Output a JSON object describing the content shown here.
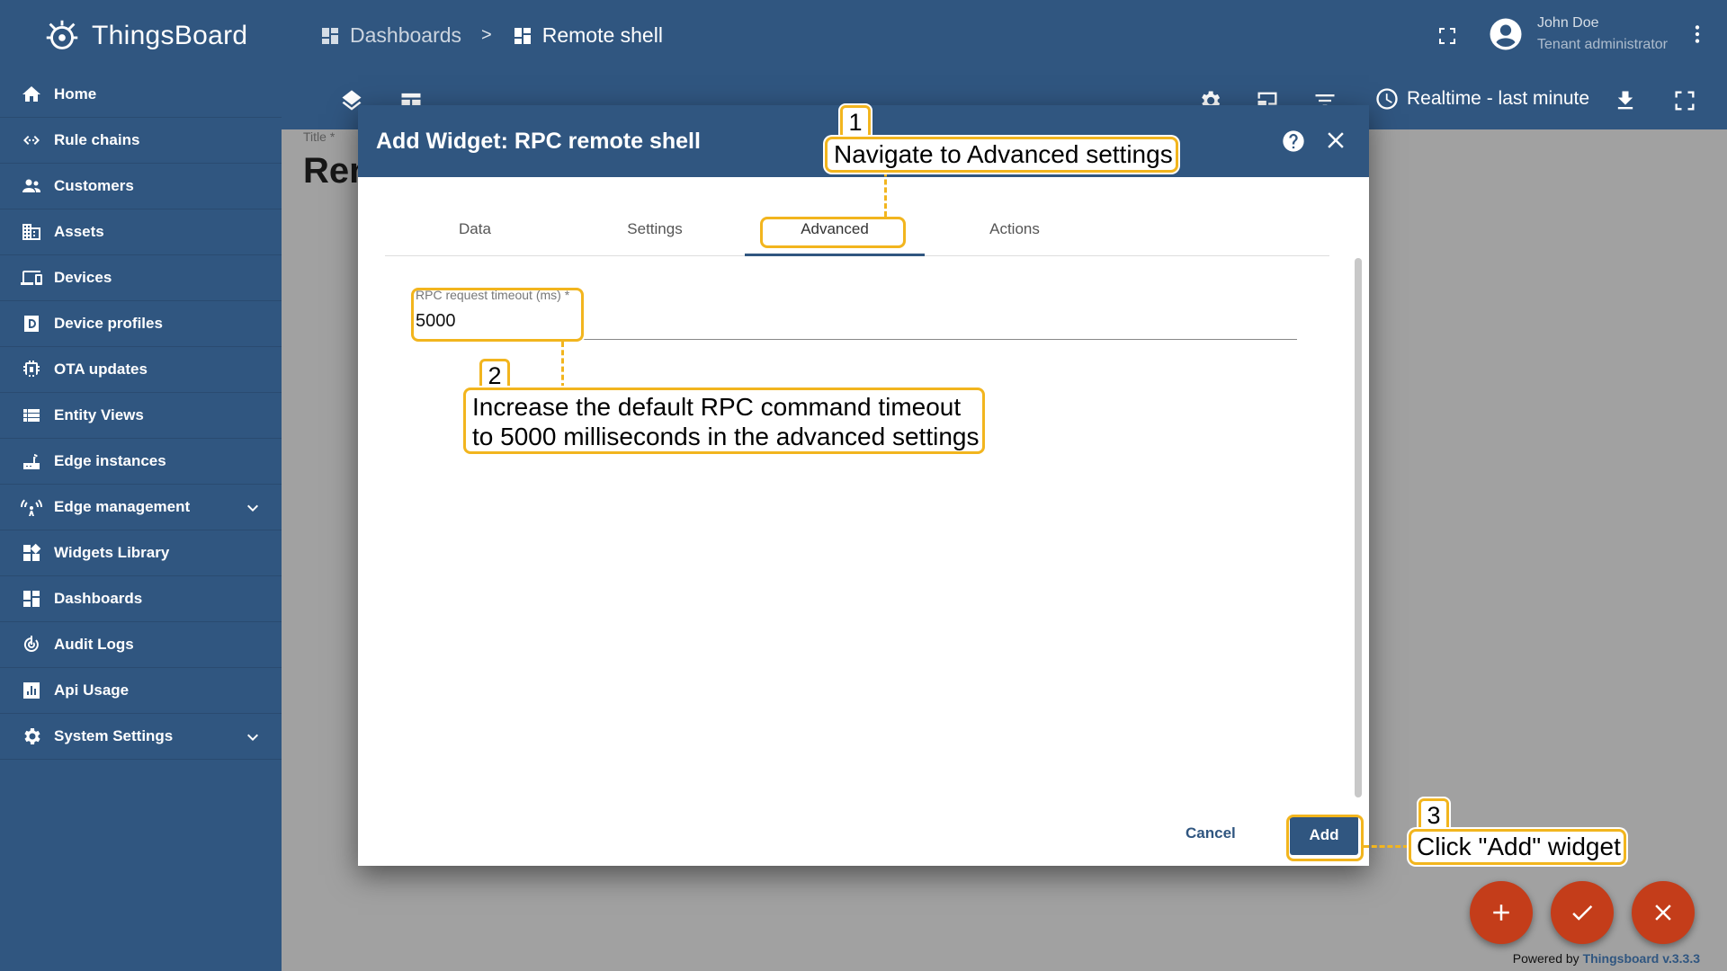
{
  "app": {
    "name": "ThingsBoard",
    "breadcrumbs": [
      "Dashboards",
      "Remote shell"
    ],
    "breadcrumb_separator": ">"
  },
  "user": {
    "name": "John Doe",
    "role": "Tenant administrator"
  },
  "sidebar": {
    "items": [
      {
        "label": "Home",
        "icon": "home-icon"
      },
      {
        "label": "Rule chains",
        "icon": "code-arrows-icon"
      },
      {
        "label": "Customers",
        "icon": "people-icon"
      },
      {
        "label": "Assets",
        "icon": "building-icon"
      },
      {
        "label": "Devices",
        "icon": "devices-icon"
      },
      {
        "label": "Device profiles",
        "icon": "profile-icon"
      },
      {
        "label": "OTA updates",
        "icon": "chip-icon"
      },
      {
        "label": "Entity Views",
        "icon": "view-list-icon"
      },
      {
        "label": "Edge instances",
        "icon": "router-icon"
      },
      {
        "label": "Edge management",
        "icon": "antenna-icon",
        "expandable": true
      },
      {
        "label": "Widgets Library",
        "icon": "widgets-icon"
      },
      {
        "label": "Dashboards",
        "icon": "dashboard-icon"
      },
      {
        "label": "Audit Logs",
        "icon": "track-changes-icon"
      },
      {
        "label": "Api Usage",
        "icon": "chart-icon"
      },
      {
        "label": "System Settings",
        "icon": "gear-icon",
        "expandable": true
      }
    ]
  },
  "toolbar": {
    "timewindow": "Realtime - last minute"
  },
  "dashboard": {
    "title_label": "Title *",
    "title_value": "Ren"
  },
  "modal": {
    "title": "Add Widget: RPC remote shell",
    "tabs": [
      "Data",
      "Settings",
      "Advanced",
      "Actions"
    ],
    "active_tab": "Advanced",
    "field": {
      "label": "RPC request timeout (ms) *",
      "value": "5000"
    },
    "cancel_label": "Cancel",
    "add_label": "Add"
  },
  "annotations": {
    "step1_num": "1",
    "step1_text": "Navigate to Advanced settings",
    "step2_num": "2",
    "step2_line1": "Increase the default RPC command timeout",
    "step2_line2": "to 5000 milliseconds in the advanced settings",
    "step3_num": "3",
    "step3_text": "Click \"Add\" widget"
  },
  "footer": {
    "powered_prefix": "Powered by ",
    "powered_brand": "Thingsboard v.3.3.3"
  },
  "colors": {
    "primary": "#305680",
    "fab": "#c43d1a",
    "highlight": "#f2b51e"
  }
}
